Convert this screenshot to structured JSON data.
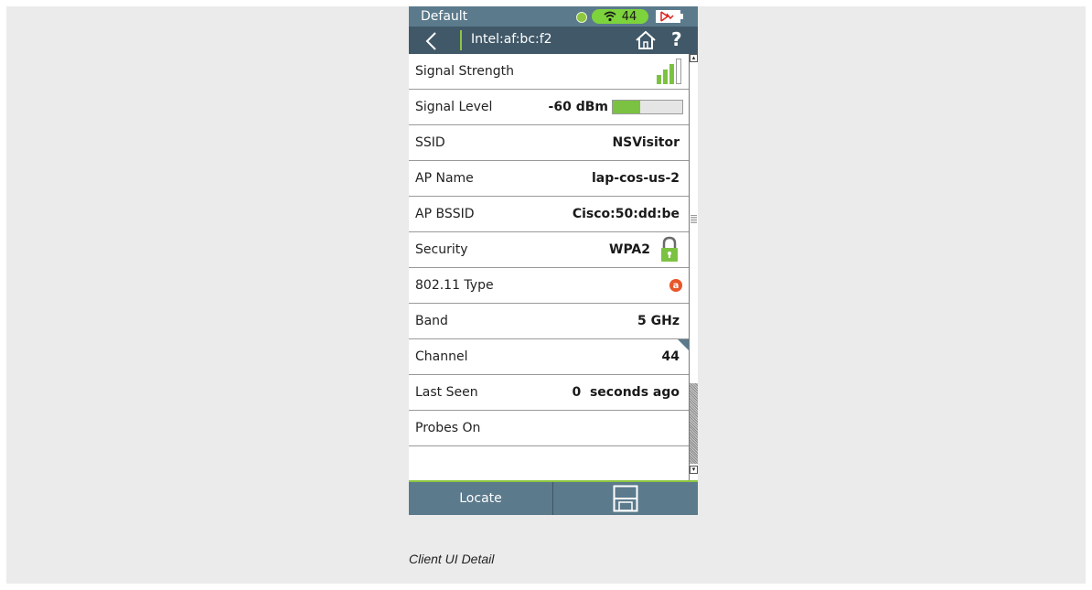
{
  "status_bar": {
    "profile": "Default",
    "channel": "44"
  },
  "nav": {
    "title": "Intel:af:bc:f2",
    "help": "?"
  },
  "rows": [
    {
      "label": "Signal Strength",
      "icon": "signal-bars-icon",
      "bars_filled": 3,
      "bars_total": 4
    },
    {
      "label": "Signal Level",
      "value": "-60 dBm",
      "level_fraction": 0.4
    },
    {
      "label": "SSID",
      "value": "NSVisitor"
    },
    {
      "label": "AP Name",
      "value": "lap-cos-us-2"
    },
    {
      "label": "AP BSSID",
      "value": "Cisco:50:dd:be"
    },
    {
      "label": "Security",
      "value": "WPA2",
      "icon": "lock-icon"
    },
    {
      "label": "802.11 Type",
      "badge": "a"
    },
    {
      "label": "Band",
      "value": "5 GHz"
    },
    {
      "label": "Channel",
      "value": "44"
    },
    {
      "label": "Last Seen",
      "value": "0  seconds ago"
    },
    {
      "label": "Probes On"
    }
  ],
  "bottom_bar": {
    "locate_label": "Locate",
    "save_icon": "floppy-save-icon"
  },
  "caption": "Client UI Detail",
  "colors": {
    "status_bar": "#5b7a8c",
    "nav_bar": "#405868",
    "accent_green": "#7cc242",
    "badge_orange": "#e8562a"
  }
}
